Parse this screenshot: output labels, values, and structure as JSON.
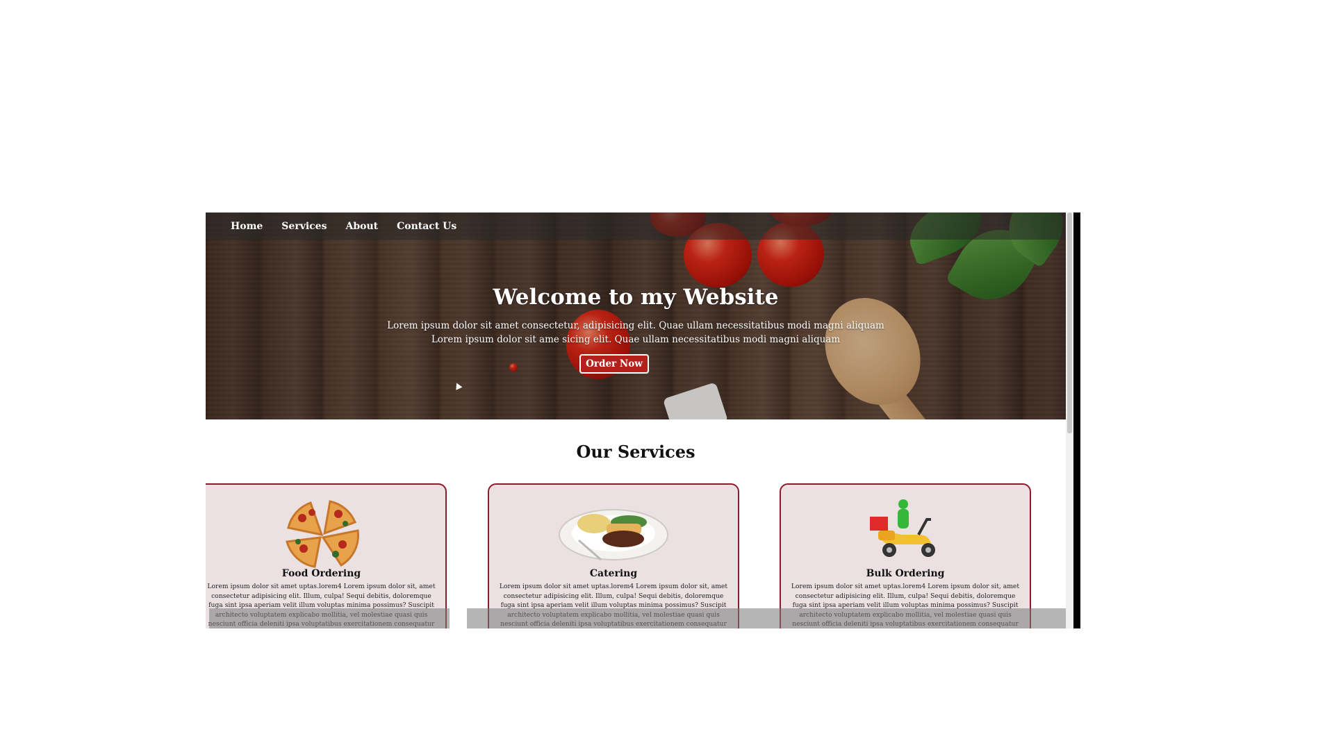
{
  "nav": {
    "items": [
      "Home",
      "Services",
      "About",
      "Contact Us"
    ]
  },
  "hero": {
    "title": "Welcome to my Website",
    "line1": "Lorem ipsum dolor sit amet consectetur, adipisicing elit. Quae ullam necessitatibus modi magni aliquam",
    "line2": "Lorem ipsum dolor sit ame sicing elit. Quae ullam necessitatibus modi magni aliquam",
    "button": "Order Now"
  },
  "services": {
    "title": "Our Services",
    "cards": [
      {
        "title": "Food Ordering",
        "icon": "pizza-icon",
        "text": "Lorem ipsum dolor sit amet uptas.lorem4 Lorem ipsum dolor sit, amet consectetur adipisicing elit. Illum, culpa! Sequi debitis, doloremque fuga sint ipsa aperiam velit illum voluptas minima possimus? Suscipit architecto voluptatem explicabo mollitia, vel molestiae quasi quis nesciunt officia deleniti ipsa voluptatibus exercitationem consequatur"
      },
      {
        "title": "Catering",
        "icon": "plate-icon",
        "text": "Lorem ipsum dolor sit amet uptas.lorem4 Lorem ipsum dolor sit, amet consectetur adipisicing elit. Illum, culpa! Sequi debitis, doloremque fuga sint ipsa aperiam velit illum voluptas minima possimus? Suscipit architecto voluptatem explicabo mollitia, vel molestiae quasi quis nesciunt officia deleniti ipsa voluptatibus exercitationem consequatur"
      },
      {
        "title": "Bulk Ordering",
        "icon": "delivery-scooter-icon",
        "text": "Lorem ipsum dolor sit amet uptas.lorem4 Lorem ipsum dolor sit, amet consectetur adipisicing elit. Illum, culpa! Sequi debitis, doloremque fuga sint ipsa aperiam velit illum voluptas minima possimus? Suscipit architecto voluptatem explicabo mollitia, vel molestiae quasi quis nesciunt officia deleniti ipsa voluptatibus exercitationem consequatur"
      }
    ]
  },
  "colors": {
    "accent": "#b3211a",
    "card_border": "#8e1a2a",
    "card_bg": "#ebe1e3"
  }
}
